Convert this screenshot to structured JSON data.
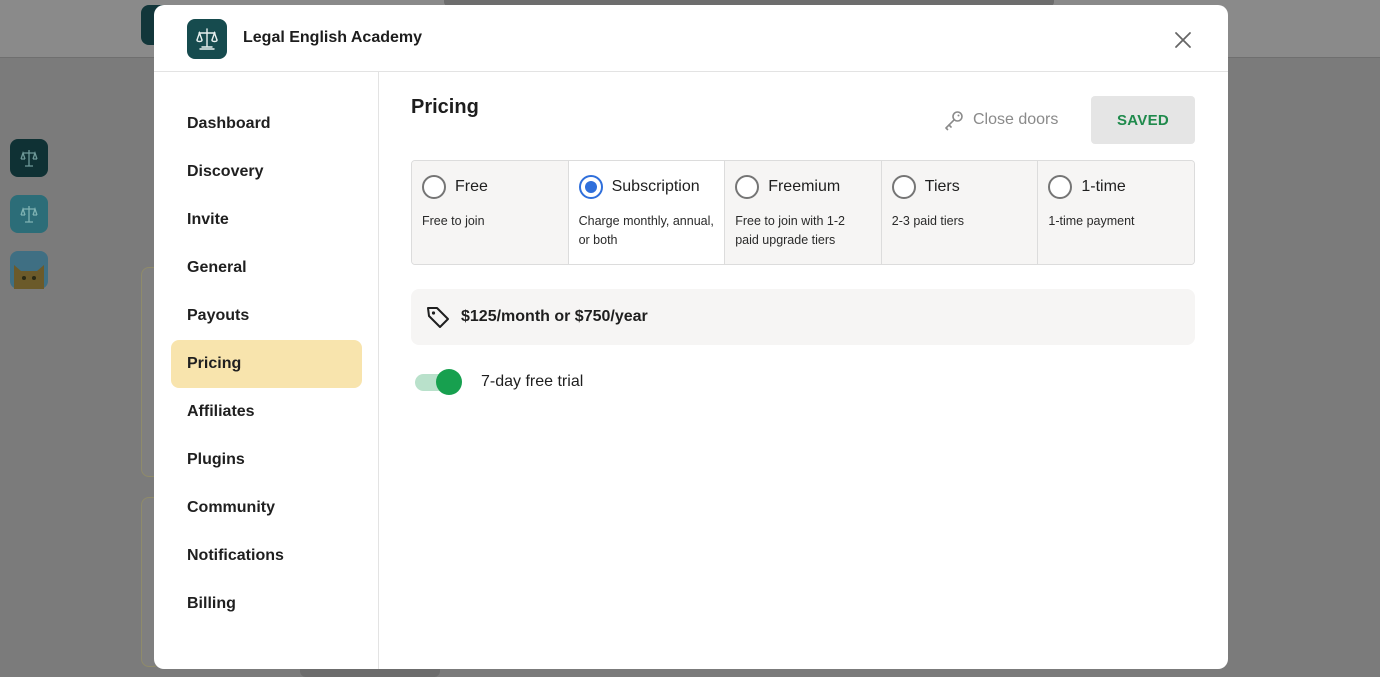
{
  "app": {
    "title": "Legal English Academy",
    "accent": "#164b4e"
  },
  "sidebar": {
    "items": [
      {
        "label": "Dashboard"
      },
      {
        "label": "Discovery"
      },
      {
        "label": "Invite"
      },
      {
        "label": "General"
      },
      {
        "label": "Payouts"
      },
      {
        "label": "Pricing",
        "active": true
      },
      {
        "label": "Affiliates"
      },
      {
        "label": "Plugins"
      },
      {
        "label": "Community"
      },
      {
        "label": "Notifications"
      },
      {
        "label": "Billing"
      }
    ],
    "active_color": "#f8e4ad"
  },
  "pricing": {
    "title": "Pricing",
    "close_doors_label": "Close doors",
    "close_doors_icon": "key-icon",
    "saved_label": "SAVED",
    "saved_color": "#1f8a4c",
    "plans": [
      {
        "name": "Free",
        "desc": "Free to join",
        "selected": false
      },
      {
        "name": "Subscription",
        "desc": "Charge monthly, annual, or both",
        "selected": true
      },
      {
        "name": "Freemium",
        "desc": "Free to join with 1-2 paid upgrade tiers",
        "selected": false
      },
      {
        "name": "Tiers",
        "desc": "2-3 paid tiers",
        "selected": false
      },
      {
        "name": "1-time",
        "desc": "1-time payment",
        "selected": false
      }
    ],
    "price_icon": "price-tag-icon",
    "price_text": "$125/month or $750/year",
    "trial": {
      "label": "7-day free trial",
      "enabled": true,
      "color": "#17a04f"
    }
  },
  "icons": {
    "close": "close-icon",
    "logo": "scales-of-justice-icon"
  }
}
